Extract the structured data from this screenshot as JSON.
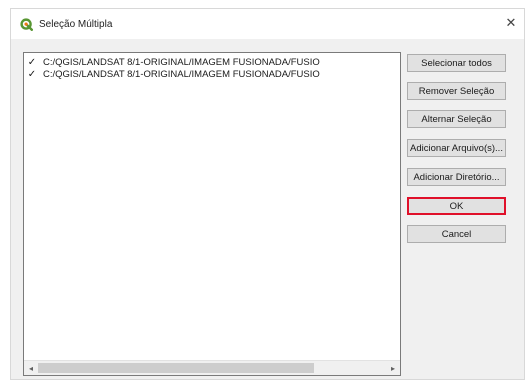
{
  "window": {
    "title": "Seleção Múltipla",
    "close_glyph": "✕",
    "icon": "qgis-logo-icon",
    "accent": "#589632"
  },
  "list": {
    "items": [
      {
        "checked": true,
        "check_glyph": "✓",
        "path": "C:/QGIS/LANDSAT 8/1-ORIGINAL/IMAGEM FUSIONADA/FUSIO"
      },
      {
        "checked": true,
        "check_glyph": "✓",
        "path": "C:/QGIS/LANDSAT 8/1-ORIGINAL/IMAGEM FUSIONADA/FUSIO"
      }
    ],
    "scroll_left": "◂",
    "scroll_right": "▸"
  },
  "buttons": {
    "select_all": "Selecionar todos",
    "remove_selection": "Remover Seleção",
    "toggle_selection": "Alternar Seleção",
    "add_files": "Adicionar Arquivo(s)...",
    "add_directory": "Adicionar Diretório...",
    "ok": "OK",
    "cancel": "Cancel"
  },
  "colors": {
    "focus_outline": "#e0102a",
    "button_face": "#e1e1e1"
  }
}
